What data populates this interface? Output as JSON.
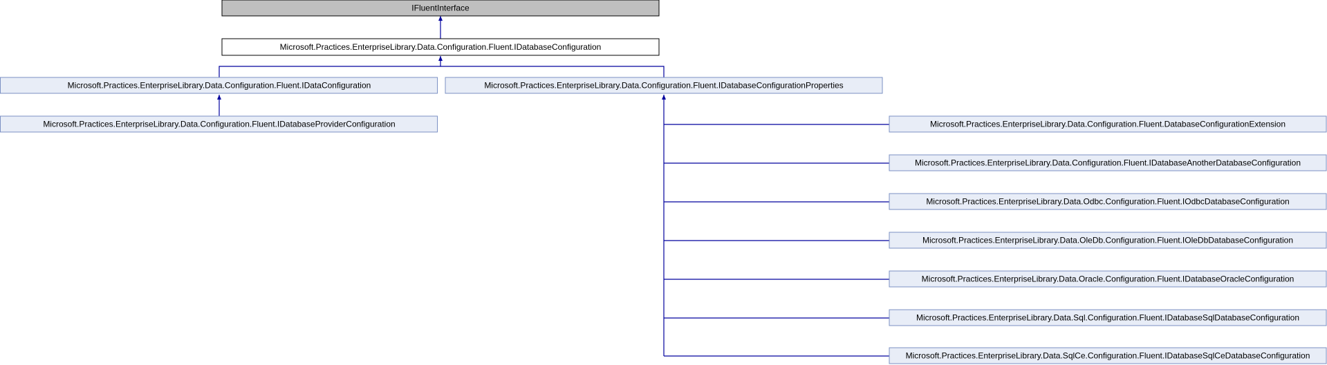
{
  "colors": {
    "root_fill": "#bfbfbf",
    "root_stroke": "#000000",
    "focus_fill": "#ffffff",
    "focus_stroke": "#000000",
    "node_fill": "#e8edf7",
    "node_stroke": "#7b90c3",
    "edge": "#00009e"
  },
  "nodes": {
    "root": "IFluentInterface",
    "database_configuration": "Microsoft.Practices.EnterpriseLibrary.Data.Configuration.Fluent.IDatabaseConfiguration",
    "data_configuration": "Microsoft.Practices.EnterpriseLibrary.Data.Configuration.Fluent.IDataConfiguration",
    "database_configuration_properties": "Microsoft.Practices.EnterpriseLibrary.Data.Configuration.Fluent.IDatabaseConfigurationProperties",
    "database_provider_configuration": "Microsoft.Practices.EnterpriseLibrary.Data.Configuration.Fluent.IDatabaseProviderConfiguration",
    "database_configuration_extension": "Microsoft.Practices.EnterpriseLibrary.Data.Configuration.Fluent.DatabaseConfigurationExtension",
    "database_another_database_configuration": "Microsoft.Practices.EnterpriseLibrary.Data.Configuration.Fluent.IDatabaseAnotherDatabaseConfiguration",
    "odbc_database_configuration": "Microsoft.Practices.EnterpriseLibrary.Data.Odbc.Configuration.Fluent.IOdbcDatabaseConfiguration",
    "oledb_database_configuration": "Microsoft.Practices.EnterpriseLibrary.Data.OleDb.Configuration.Fluent.IOleDbDatabaseConfiguration",
    "database_oracle_configuration": "Microsoft.Practices.EnterpriseLibrary.Data.Oracle.Configuration.Fluent.IDatabaseOracleConfiguration",
    "database_sql_database_configuration": "Microsoft.Practices.EnterpriseLibrary.Data.Sql.Configuration.Fluent.IDatabaseSqlDatabaseConfiguration",
    "database_sqlce_database_configuration": "Microsoft.Practices.EnterpriseLibrary.Data.SqlCe.Configuration.Fluent.IDatabaseSqlCeDatabaseConfiguration"
  }
}
